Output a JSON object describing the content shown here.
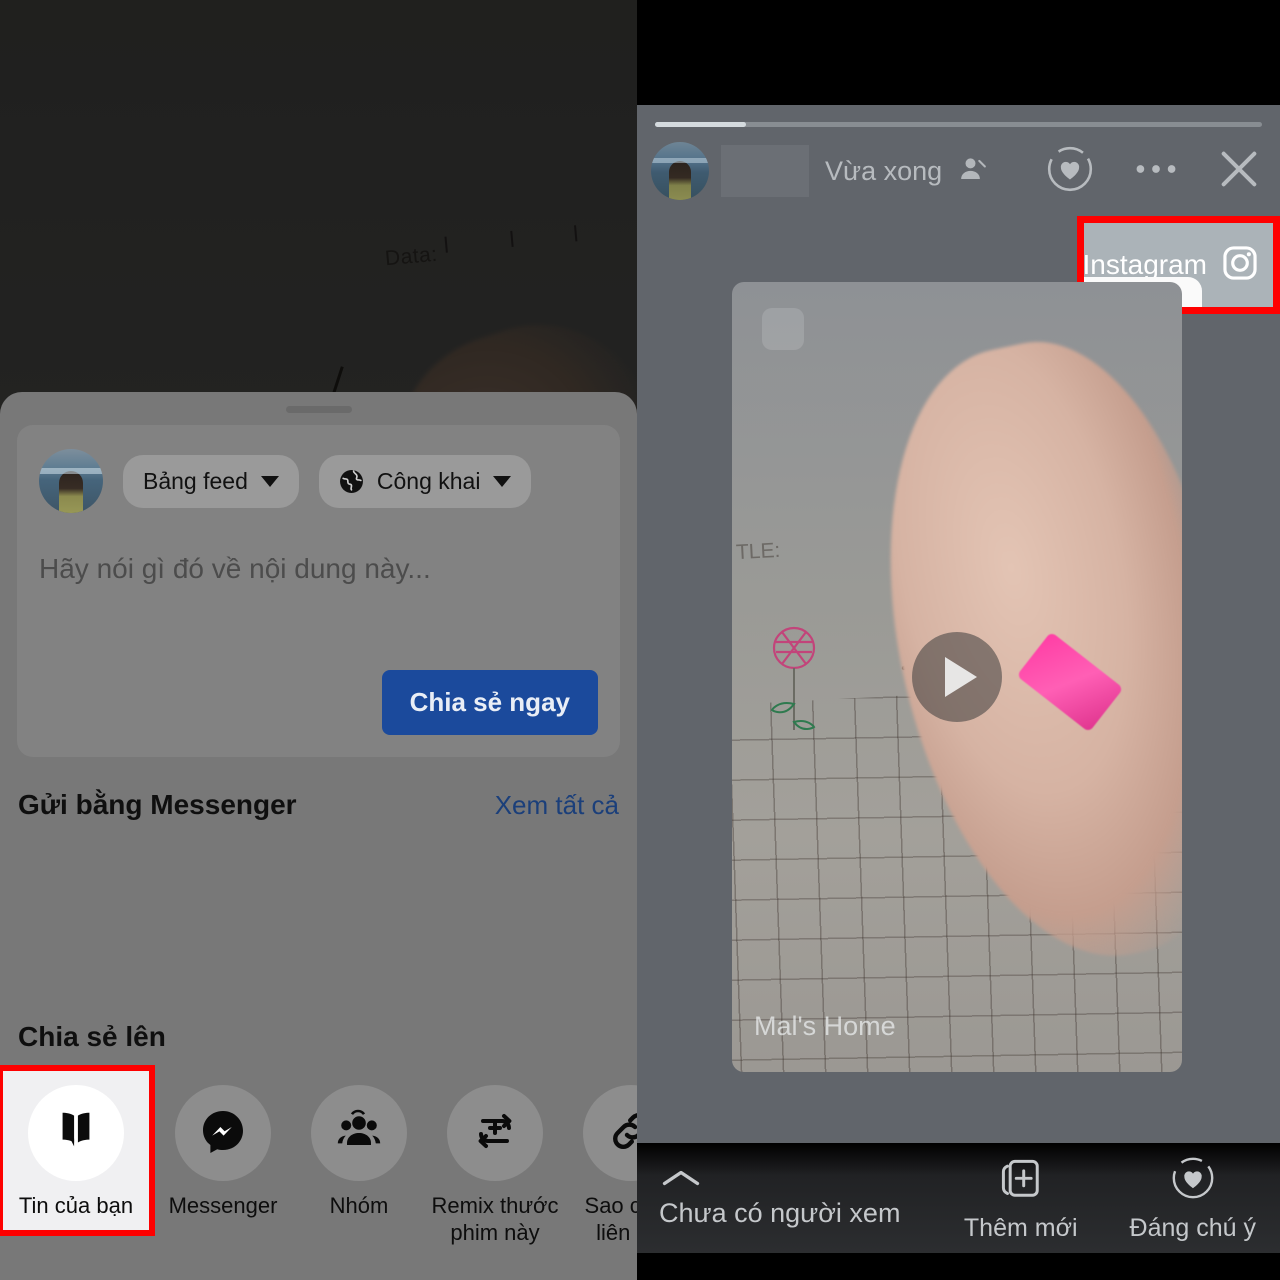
{
  "left_panel": {
    "background_photo": {
      "visible_text": "Data:",
      "description": "grid-paper-notebook-with-hand"
    },
    "sheet": {
      "composer": {
        "avatar": "user-profile-photo",
        "destination_pill": "Bảng feed",
        "privacy_pill": "Công khai",
        "placeholder": "Hãy nói gì đó về nội dung này...",
        "share_button": "Chia sẻ ngay"
      },
      "messenger_section": {
        "title": "Gửi bằng Messenger",
        "see_all": "Xem tất cả"
      },
      "share_to_section": {
        "title": "Chia sẻ lên",
        "items": [
          {
            "label": "Tin của bạn",
            "icon": "story-book-icon",
            "selected": true
          },
          {
            "label": "Messenger",
            "icon": "messenger-icon",
            "selected": false
          },
          {
            "label": "Nhóm",
            "icon": "groups-icon",
            "selected": false
          },
          {
            "label": "Remix thước phim này",
            "icon": "remix-icon",
            "selected": false
          },
          {
            "label": "Sao chép liên kết",
            "icon": "link-icon",
            "selected": false
          }
        ]
      }
    }
  },
  "right_panel": {
    "progress_percent": 15,
    "header": {
      "avatar": "user-profile-photo",
      "username_redacted": "",
      "timestamp": "Vừa xong",
      "audience_icon": "audience-person-icon",
      "actions": [
        {
          "name": "highlight-heart-icon",
          "label": ""
        },
        {
          "name": "more-options-icon",
          "label": ""
        },
        {
          "name": "close-icon",
          "label": ""
        }
      ]
    },
    "instagram_chip": {
      "label": "Instagram",
      "icon": "instagram-icon",
      "highlight_color": "#fe0000"
    },
    "story_card": {
      "caption": "Mal's Home",
      "title_text": "TLE:",
      "play_icon": "play-icon"
    },
    "bottom_bar": {
      "viewers_text": "Chưa có người xem",
      "chevron_icon": "chevron-up-icon",
      "actions": [
        {
          "label": "Thêm mới",
          "icon": "add-card-icon"
        },
        {
          "label": "Đáng chú ý",
          "icon": "highlight-heart-icon"
        }
      ]
    }
  },
  "colors": {
    "sheet_bg": "#787878",
    "composer_bg": "#828282",
    "primary_blue": "#1b4a9c",
    "link_blue": "#1b3f7a",
    "highlight_red": "#fe0000",
    "story_bg": "#61656b",
    "instagram_chip_bg": "#abb3b8"
  }
}
